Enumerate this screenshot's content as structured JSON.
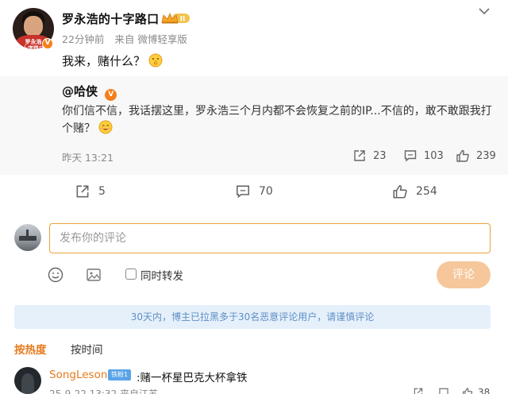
{
  "post": {
    "author": "罗永浩的十字路口",
    "time": "22分钟前",
    "source": "来自 微博轻享版",
    "text": "我来，赌什么？",
    "verified_badge": "V",
    "vip_icon": "crown-badge-icon"
  },
  "repost": {
    "author": "@哈侠",
    "text": "你们信不信，我话摆这里，罗永浩三个月内都不会恢复之前的IP...不信的，敢不敢跟我打个赌？",
    "time": "昨天 13:21",
    "shares": "23",
    "comments": "103",
    "likes": "239"
  },
  "actions": {
    "shares": "5",
    "comments": "70",
    "likes": "254"
  },
  "composer": {
    "placeholder": "发布你的评论",
    "repost_label": "同时转发",
    "submit_label": "评论"
  },
  "notice": "30天内，博主已拉黑多于30名恶意评论用户，请谨慎评论",
  "sort": {
    "hot": "按热度",
    "time": "按时间"
  },
  "comment": {
    "user": "SongLeson",
    "badge": "铁粉1",
    "text": ":赌一杯星巴克大杯拿铁",
    "meta": "25-9-22 13:32 来自江苏",
    "likes": "38"
  },
  "colors": {
    "accent": "#e67a1d",
    "notice_bg": "#e5f0fb",
    "notice_text": "#5f8fc4",
    "submit_bg": "#f6c79b",
    "input_border": "#e8a33a"
  }
}
